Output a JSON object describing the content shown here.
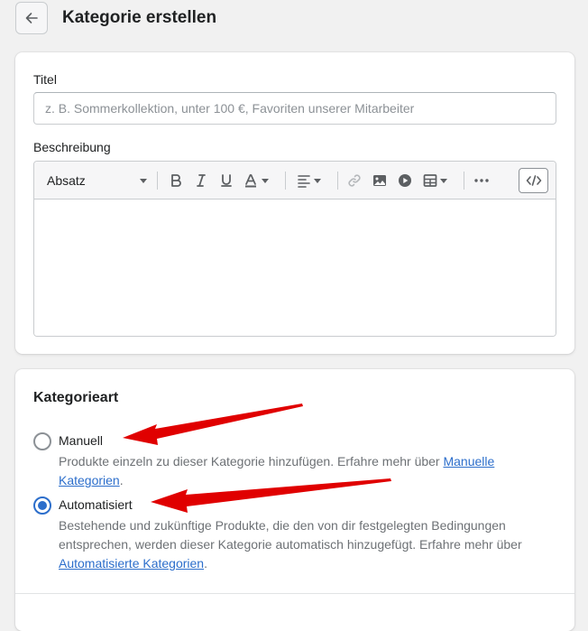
{
  "header": {
    "back_icon": "arrow-left-icon",
    "title": "Kategorie erstellen"
  },
  "title_field": {
    "label": "Titel",
    "value": "",
    "placeholder": "z. B. Sommerkollektion, unter 100 €, Favoriten unserer Mitarbeiter"
  },
  "description_field": {
    "label": "Beschreibung",
    "toolbar": {
      "format_select": "Absatz",
      "icons": [
        "bold-icon",
        "italic-icon",
        "underline-icon",
        "text-color-icon",
        "align-left-icon",
        "link-icon",
        "image-icon",
        "video-icon",
        "table-icon",
        "more-icon",
        "code-icon"
      ]
    },
    "value": ""
  },
  "category_type": {
    "title": "Kategorieart",
    "selected": "automatisiert",
    "options": [
      {
        "label": "Manuell",
        "help_text": "Produkte einzeln zu dieser Kategorie hinzufügen. Erfahre mehr über ",
        "help_link": "Manuelle Kategorien",
        "help_suffix": "."
      },
      {
        "label": "Automatisiert",
        "help_text": "Bestehende und zukünftige Produkte, die den von dir festgelegten Bedingungen entsprechen, werden dieser Kategorie automatisch hinzugefügt. Erfahre mehr über ",
        "help_link": "Automatisierte Kategorien",
        "help_suffix": "."
      }
    ]
  },
  "colors": {
    "accent": "#2c6ecb",
    "annotation_arrow": "#e00000"
  }
}
